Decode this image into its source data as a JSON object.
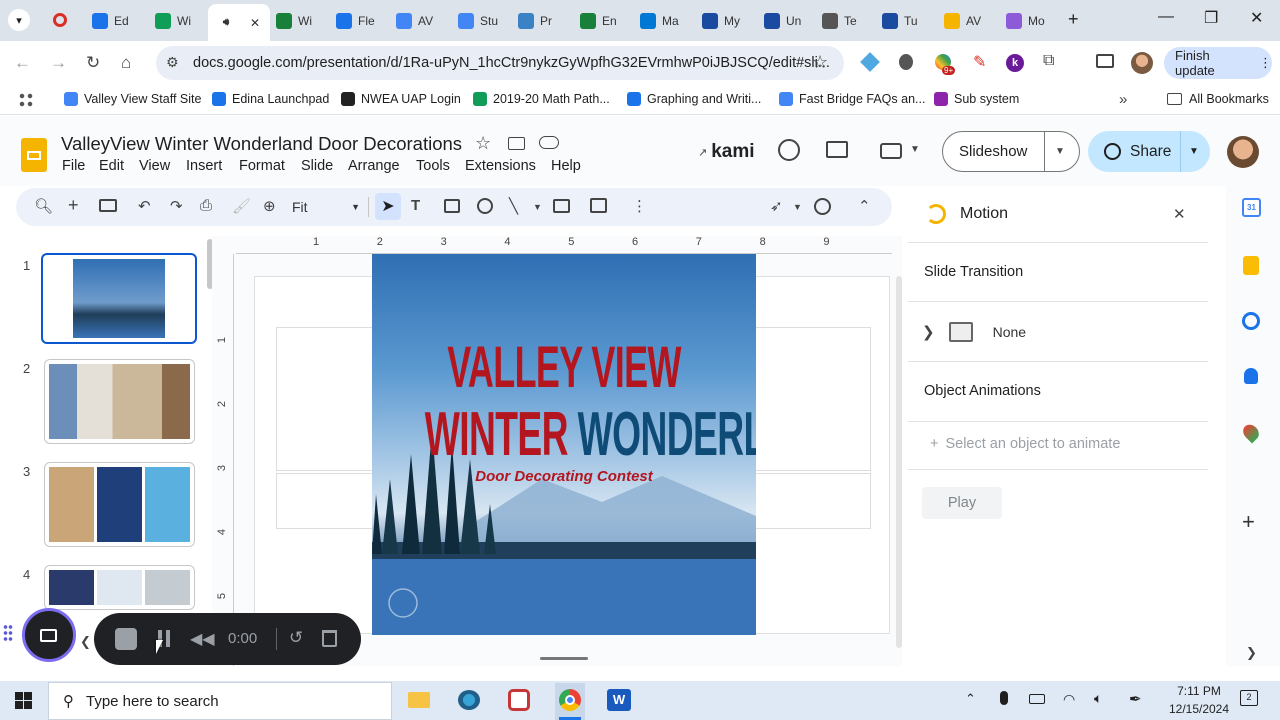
{
  "browser": {
    "tabs": [
      {
        "label": "Ed",
        "color": "#1a73e8"
      },
      {
        "label": "Wi",
        "color": "#0f9d58"
      },
      {
        "label": "",
        "color": "#1a73e8",
        "active": true
      },
      {
        "label": "Wi",
        "color": "#188038"
      },
      {
        "label": "Fle",
        "color": "#1a73e8"
      },
      {
        "label": "AV",
        "color": "#4285f4"
      },
      {
        "label": "Stu",
        "color": "#4285f4"
      },
      {
        "label": "Pr",
        "color": "#3b82c4"
      },
      {
        "label": "En",
        "color": "#188038"
      },
      {
        "label": "Ma",
        "color": "#0078d4"
      },
      {
        "label": "My",
        "color": "#1a4ba0"
      },
      {
        "label": "Un",
        "color": "#1a4ba0"
      },
      {
        "label": "Te",
        "color": "#555555"
      },
      {
        "label": "Tu",
        "color": "#1a4ba0"
      },
      {
        "label": "AV",
        "color": "#f4b400"
      },
      {
        "label": "Mo",
        "color": "#8e5bd8"
      }
    ],
    "url": "docs.google.com/presentation/d/1Ra-uPyN_1hcCtr9nykzGyWpfhG32EVrmhwP0iJBJSCQ/edit#sli...",
    "finish_update": "Finish update",
    "badge": "9+",
    "bookmarks": [
      {
        "label": "Valley View Staff Site",
        "color": "#4285f4"
      },
      {
        "label": "Edina Launchpad",
        "color": "#1a73e8"
      },
      {
        "label": "NWEA UAP Login",
        "color": "#222222"
      },
      {
        "label": "2019-20 Math Path...",
        "color": "#0f9d58"
      },
      {
        "label": "Graphing and Writi...",
        "color": "#1a73e8"
      },
      {
        "label": "Fast Bridge FAQs an...",
        "color": "#4285f4"
      },
      {
        "label": "Sub system",
        "color": "#8e24aa"
      }
    ],
    "all_bookmarks": "All Bookmarks"
  },
  "slides": {
    "doc_title": "ValleyView Winter Wonderland Door Decorations",
    "menu": [
      "File",
      "Edit",
      "View",
      "Insert",
      "Format",
      "Slide",
      "Arrange",
      "Tools",
      "Extensions",
      "Help"
    ],
    "kami": "kami",
    "slideshow": "Slideshow",
    "share": "Share",
    "zoom": "Fit",
    "ruler_h": [
      "1",
      "2",
      "3",
      "4",
      "5",
      "6",
      "7",
      "8",
      "9"
    ],
    "ruler_v": [
      "1",
      "2",
      "3",
      "4",
      "5"
    ],
    "thumbnails": [
      "1",
      "2",
      "3",
      "4"
    ]
  },
  "poster": {
    "line1": "VALLEY VIEW",
    "line2a": "WINTER",
    "line2b": "WONDERLAND",
    "subtitle": "Door Decorating Contest"
  },
  "motion": {
    "title": "Motion",
    "slide_transition": "Slide Transition",
    "transition_value": "None",
    "object_animations": "Object Animations",
    "select_object": "Select an object to animate",
    "play": "Play"
  },
  "recorder": {
    "time": "0:00"
  },
  "taskbar": {
    "search_placeholder": "Type here to search",
    "time": "7:11 PM",
    "date": "12/15/2024"
  }
}
